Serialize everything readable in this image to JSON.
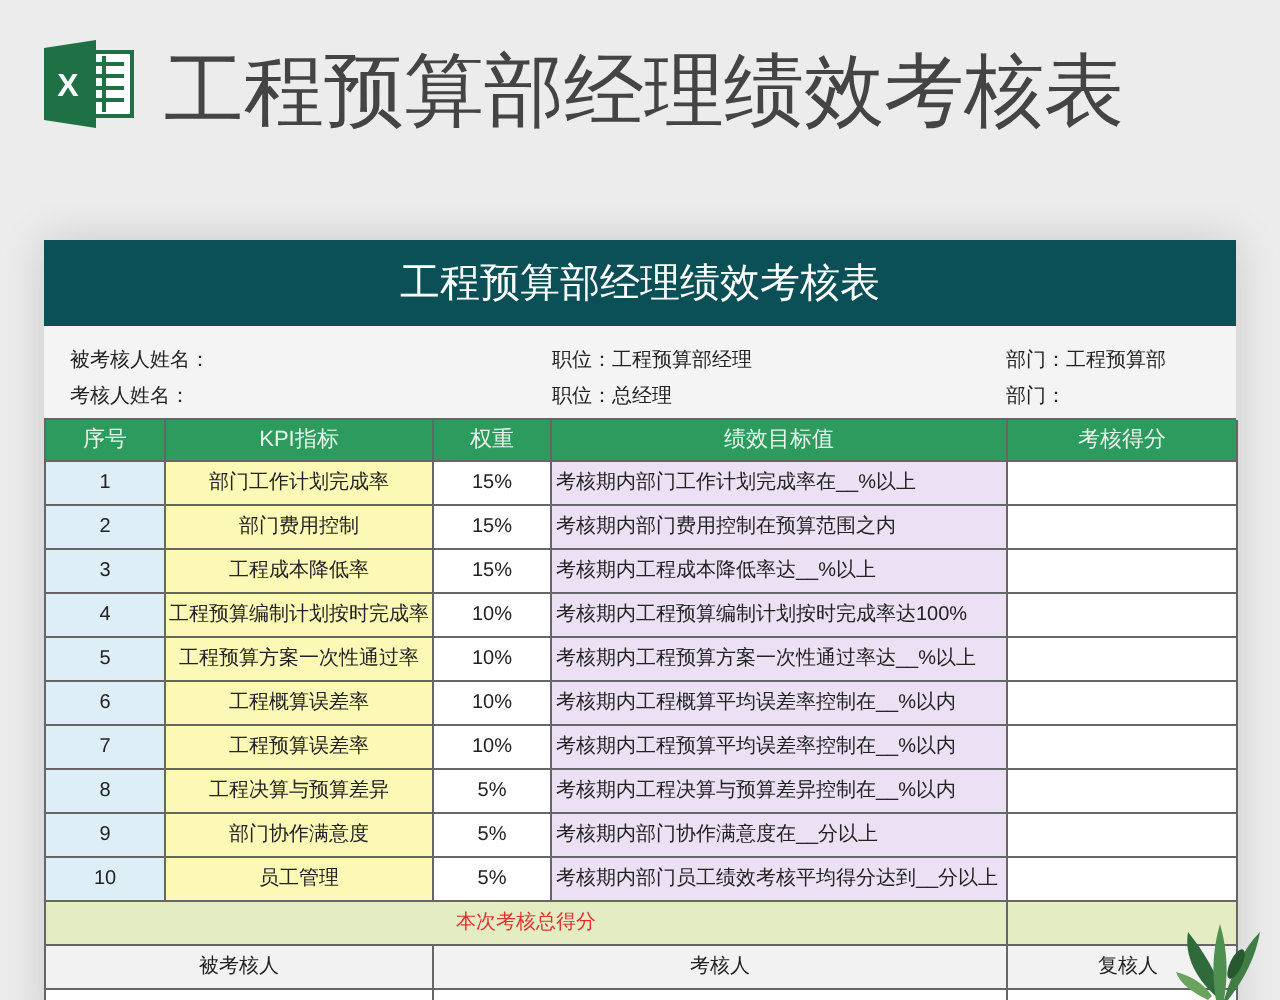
{
  "logo": {
    "letter": "X"
  },
  "heading": "工程预算部经理绩效考核表",
  "sheet": {
    "title": "工程预算部经理绩效考核表",
    "info": [
      [
        "被考核人姓名：",
        "职位：工程预算部经理",
        "部门：工程预算部"
      ],
      [
        "考核人姓名：",
        "职位：总经理",
        "部门："
      ]
    ],
    "columns": [
      "序号",
      "KPI指标",
      "权重",
      "绩效目标值",
      "考核得分"
    ],
    "rows": [
      {
        "no": "1",
        "kpi": "部门工作计划完成率",
        "weight": "15%",
        "target": "考核期内部门工作计划完成率在__%以上"
      },
      {
        "no": "2",
        "kpi": "部门费用控制",
        "weight": "15%",
        "target": "考核期内部门费用控制在预算范围之内"
      },
      {
        "no": "3",
        "kpi": "工程成本降低率",
        "weight": "15%",
        "target": "考核期内工程成本降低率达__%以上"
      },
      {
        "no": "4",
        "kpi": "工程预算编制计划按时完成率",
        "weight": "10%",
        "target": "考核期内工程预算编制计划按时完成率达100%"
      },
      {
        "no": "5",
        "kpi": "工程预算方案一次性通过率",
        "weight": "10%",
        "target": "考核期内工程预算方案一次性通过率达__%以上"
      },
      {
        "no": "6",
        "kpi": "工程概算误差率",
        "weight": "10%",
        "target": "考核期内工程概算平均误差率控制在__%以内"
      },
      {
        "no": "7",
        "kpi": "工程预算误差率",
        "weight": "10%",
        "target": "考核期内工程预算平均误差率控制在__%以内"
      },
      {
        "no": "8",
        "kpi": "工程决算与预算差异",
        "weight": "5%",
        "target": "考核期内工程决算与预算差异控制在__%以内"
      },
      {
        "no": "9",
        "kpi": "部门协作满意度",
        "weight": "5%",
        "target": "考核期内部门协作满意度在__分以上"
      },
      {
        "no": "10",
        "kpi": "员工管理",
        "weight": "5%",
        "target": "考核期内部门员工绩效考核平均得分达到__分以上"
      }
    ],
    "total_label": "本次考核总得分",
    "signatures": [
      "被考核人",
      "考核人",
      "复核人"
    ]
  }
}
